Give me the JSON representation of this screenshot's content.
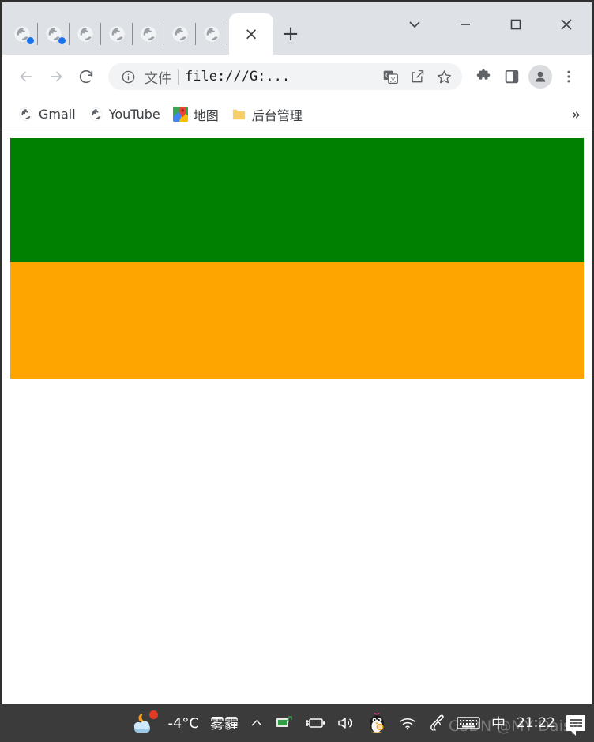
{
  "browser": {
    "tabs": {
      "collapsed": [
        {
          "icon": "globe-icon",
          "badge": "blue-dot"
        },
        {
          "icon": "globe-icon",
          "badge": "blue-dot"
        },
        {
          "icon": "globe-icon",
          "badge": ""
        },
        {
          "icon": "globe-icon",
          "badge": ""
        },
        {
          "icon": "globe-icon",
          "badge": ""
        },
        {
          "icon": "globe-icon",
          "badge": ""
        },
        {
          "icon": "globe-icon",
          "badge": ""
        }
      ],
      "active_close_label": "×",
      "new_tab_label": "+"
    },
    "window_controls": {
      "tab_search": "tab-search-chevron-icon",
      "minimize": "minimize-icon",
      "maximize": "maximize-icon",
      "close": "close-icon"
    },
    "toolbar": {
      "back": "back-arrow-icon",
      "forward": "forward-arrow-icon",
      "reload": "reload-icon",
      "site_info": "info-circle-icon",
      "scheme_label": "文件",
      "url": "file:///G:...",
      "translate": "translate-icon",
      "share": "share-icon",
      "bookmark": "star-icon",
      "extensions": "puzzle-icon",
      "side_panel": "side-panel-icon",
      "profile": "profile-avatar-icon",
      "menu": "three-dot-menu-icon"
    },
    "bookmarks": {
      "items": [
        {
          "label": "Gmail",
          "icon": "globe-icon"
        },
        {
          "label": "YouTube",
          "icon": "globe-icon"
        },
        {
          "label": "地图",
          "icon": "google-maps-icon"
        },
        {
          "label": "后台管理",
          "icon": "folder-icon"
        }
      ],
      "overflow_label": "»"
    },
    "page": {
      "blocks": [
        {
          "name": "green-block",
          "color": "#008000"
        },
        {
          "name": "orange-block",
          "color": "#FFA500"
        }
      ]
    }
  },
  "taskbar": {
    "weather": {
      "icon": "moon-cloud-weather-icon",
      "temperature": "-4°C",
      "condition": "雾霾",
      "badge": "red-dot"
    },
    "tray": {
      "expand": "chevron-up-icon",
      "display": "display-monitor-icon",
      "battery": "battery-charging-icon",
      "volume": "speaker-icon",
      "qq": "qq-penguin-icon",
      "wifi": "wifi-icon",
      "pen": "pen-tool-icon",
      "keyboard": "keyboard-icon",
      "ime_label": "中",
      "clock": "21:22",
      "notifications": "notification-center-icon"
    },
    "watermark": "CSDN @MY Daisy"
  }
}
